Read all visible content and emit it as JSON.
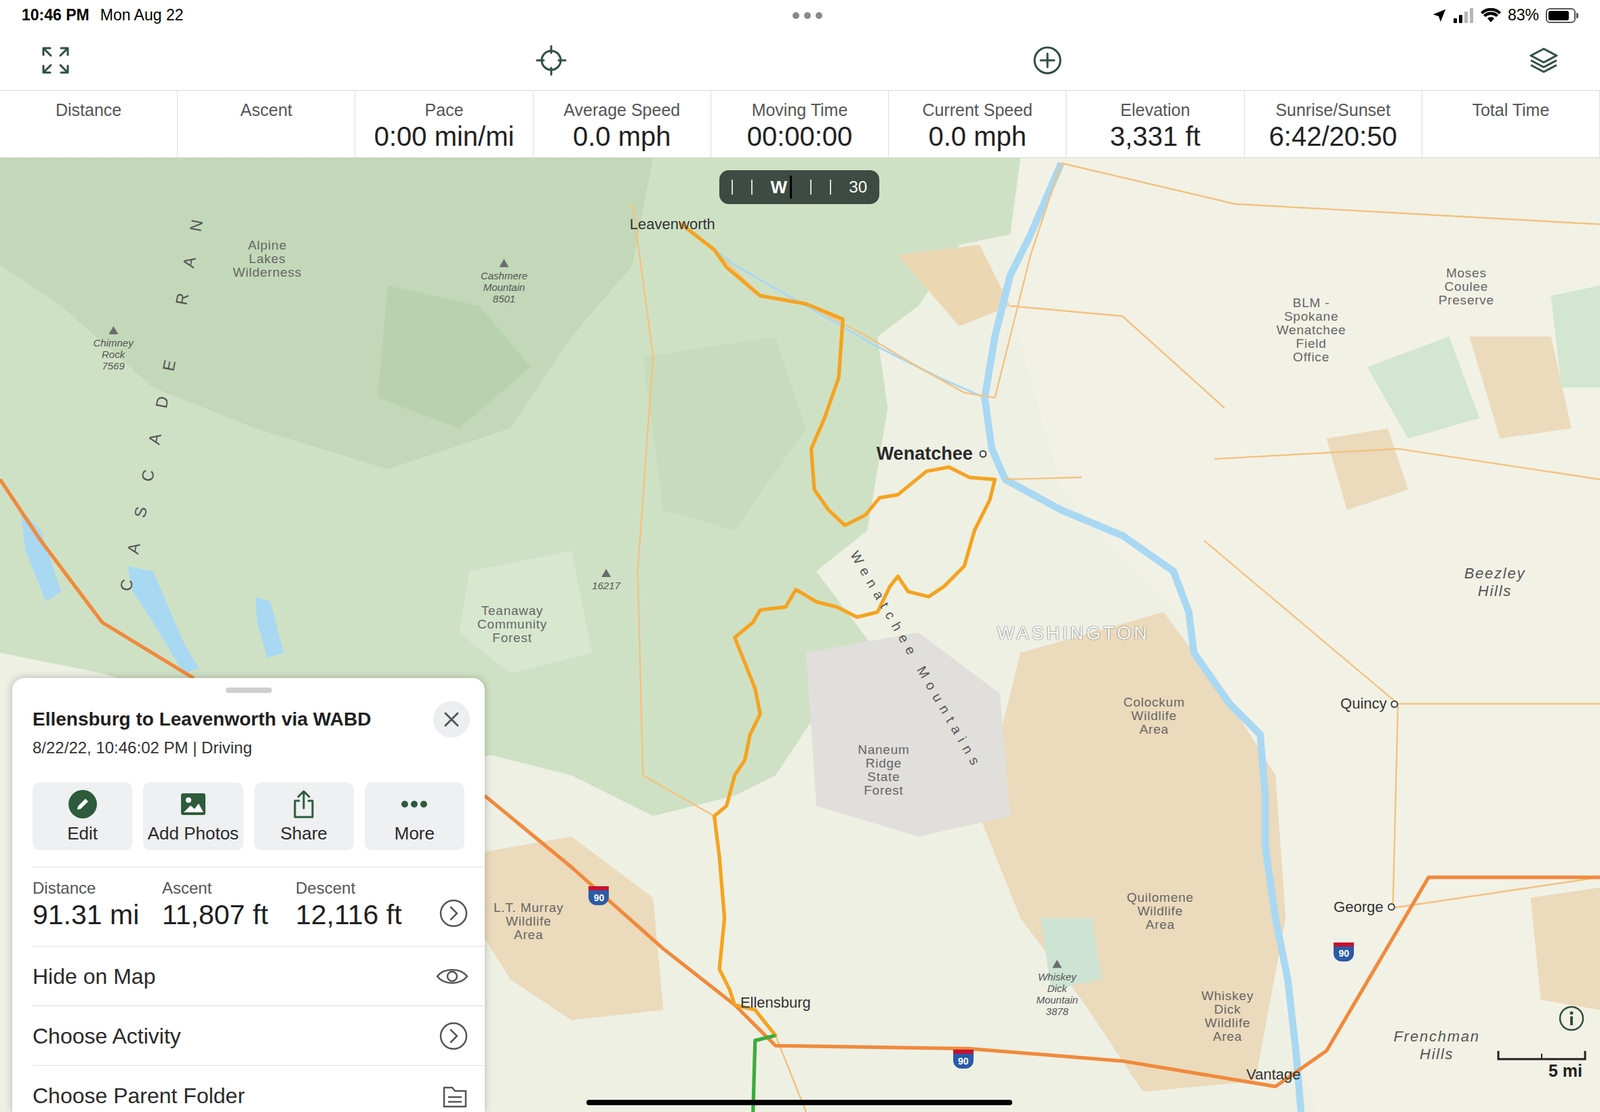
{
  "status_bar": {
    "time": "10:46 PM",
    "date": "Mon Aug 22",
    "battery": {
      "percent": "83%",
      "level": 0.83
    }
  },
  "stats": [
    {
      "label": "Distance"
    },
    {
      "label": "Ascent"
    },
    {
      "label": "Pace",
      "value": "0:00 min/mi"
    },
    {
      "label": "Average Speed",
      "value": "0.0 mph"
    },
    {
      "label": "Moving Time",
      "value": "00:00:00"
    },
    {
      "label": "Current Speed",
      "value": "0.0 mph"
    },
    {
      "label": "Elevation",
      "value": "3,331 ft"
    },
    {
      "label": "Sunrise/Sunset",
      "value": "6:42/20:50"
    },
    {
      "label": "Total Time"
    }
  ],
  "heading": {
    "cardinal": "W",
    "degrees": "30"
  },
  "map": {
    "labels": [
      {
        "text": "Leavenworth",
        "kind": "town"
      },
      {
        "text": "Alpine Lakes Wilderness",
        "kind": "area"
      },
      {
        "text": "Cashmere Mountain 8501",
        "kind": "peak"
      },
      {
        "text": "Chimney Rock 7569",
        "kind": "peak"
      },
      {
        "text": "CASCADE RAN",
        "kind": "range"
      },
      {
        "text": "Wenatchee",
        "kind": "city"
      },
      {
        "text": "Wenatchee Mountains",
        "kind": "mountains"
      },
      {
        "text": "16217",
        "kind": "peak"
      },
      {
        "text": "Teanaway Community Forest",
        "kind": "area"
      },
      {
        "text": "WASHINGTON",
        "kind": "state"
      },
      {
        "text": "Moses Coulee Preserve",
        "kind": "area"
      },
      {
        "text": "BLM - Spokane Wenatchee Field Office",
        "kind": "area"
      },
      {
        "text": "Beezley Hills",
        "kind": "region"
      },
      {
        "text": "Quincy",
        "kind": "hamlet"
      },
      {
        "text": "Colockum Wildlife Area",
        "kind": "area"
      },
      {
        "text": "Naneum Ridge State Forest",
        "kind": "area"
      },
      {
        "text": "L.T. Murray Wildlife Area",
        "kind": "area"
      },
      {
        "text": "George",
        "kind": "hamlet"
      },
      {
        "text": "Quilomene Wildlife Area",
        "kind": "area"
      },
      {
        "text": "Whiskey Dick Mountain 3878",
        "kind": "peak"
      },
      {
        "text": "Whiskey Dick Wildlife Area",
        "kind": "area"
      },
      {
        "text": "Frenchman Hills",
        "kind": "region"
      },
      {
        "text": "Ellensburg",
        "kind": "town"
      },
      {
        "text": "Vantage",
        "kind": "town"
      }
    ],
    "shields": [
      "90",
      "90",
      "90"
    ],
    "scale": "5 mi"
  },
  "track": {
    "title": "Ellensburg to Leavenworth via WABD",
    "subtitle": "8/22/22, 10:46:02 PM | Driving",
    "actions": [
      "Edit",
      "Add Photos",
      "Share",
      "More"
    ],
    "stats": [
      {
        "label": "Distance",
        "value": "91.31 mi"
      },
      {
        "label": "Ascent",
        "value": "11,807 ft"
      },
      {
        "label": "Descent",
        "value": "12,116 ft"
      }
    ],
    "rows": [
      "Hide on Map",
      "Choose Activity",
      "Choose Parent Folder"
    ]
  }
}
